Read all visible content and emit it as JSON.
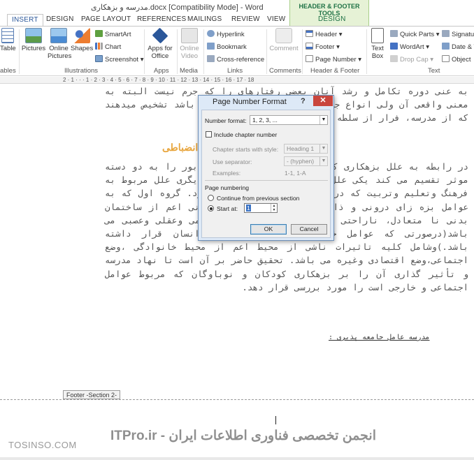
{
  "window": {
    "title": "مدرسه و بزهکاری.docx [Compatibility Mode] - Word",
    "contextual_group": "HEADER & FOOTER TOOLS"
  },
  "tabs": [
    "INSERT",
    "DESIGN",
    "PAGE LAYOUT",
    "REFERENCES",
    "MAILINGS",
    "REVIEW",
    "VIEW",
    "DESIGN"
  ],
  "ribbon": {
    "table_partial": "Table",
    "tables_group_partial": "ables",
    "pictures": "Pictures",
    "online_pictures": "Online Pictures",
    "shapes": "Shapes",
    "smartart": "SmartArt",
    "chart": "Chart",
    "screenshot": "Screenshot",
    "illustrations_group": "Illustrations",
    "apps_for_office": "Apps for Office",
    "apps_group": "Apps",
    "online_video": "Online Video",
    "media_group": "Media",
    "hyperlink": "Hyperlink",
    "bookmark": "Bookmark",
    "cross_reference": "Cross-reference",
    "links_group": "Links",
    "comment": "Comment",
    "comments_group": "Comments",
    "header": "Header",
    "footer": "Footer",
    "page_number": "Page Number",
    "header_footer_group": "Header & Footer",
    "text_box": "Text Box",
    "quick_parts": "Quick Parts",
    "wordart": "WordArt",
    "drop_cap": "Drop Cap",
    "signature_partial": "Signatu",
    "date_time_partial": "Date & T",
    "object": "Object",
    "text_group": "Text"
  },
  "ruler": {
    "ticks": "2 · 1 · · · 1 · 2 · 3 · 4 · 5 · 6 · 7 · 8 · 9 · 10 · 11 · 12 · 13 · 14 · 15 · 16 · 17 · 18"
  },
  "document": {
    "para1": "به عنی دوره تکامل و رشد آنان بعضی رفتارهای را که جرم نیست البته به معنی واقعی آن ولی انواع جرایم و حرفهای شدن آنان می باشد تشخیص میدهند که از مدرسه، فرار از سلطه والدین و خانواده و ....",
    "heading": "بزهکاری و بی انضباطی",
    "para2": "در رابطه به علل بزهکاری کودکان و نوجوانان عوامل مابور را به دو دسته موثر تقسیم می کند یکی علل مربوط به شخص بزهکار و دیگری علل مربوط به فرهنگ وتعلیم وتربیت که در خارج از وجود او قرار دارد. گروه اول که به عوامل بزه زای درونی و ذاتی و خصوصیات انسانی وروانی اعم از ساختمان بدنی نا متعادل، ناراحتی های روانی، بیماری های جسمی وعقلی وعصبی می باشد(درصورتی که عوامل خارجی در خارج از شخص انسان قرار داشته باشد.)وشامل کلیه تاثیرات ناشی از محیط اعم از محیط خانوادگی ،وضع اجتماعی،وضع اقتصادی وغیره می باشد. تحقیق حاضر بر آن است تا نهاد مدرسه و تأثیر گذاری آن را بر بزهکاری کودکان و نوباوگان که مربوط عوامل اجتماعی و خارجی است را مورد بررسی قرار دهد.",
    "subhead": "مدرسه عامل جامعه پذیری :"
  },
  "footer": {
    "section_tag": "Footer -Section 2-",
    "watermark_left": "TOSINSO.COM",
    "watermark_main": "ITPro.ir - انجمن تخصصی فناوری اطلاعات ایران"
  },
  "dialog": {
    "title": "Page Number Format",
    "help": "?",
    "close": "✕",
    "number_format_label": "Number format:",
    "number_format_value": "1, 2, 3, ...",
    "include_chapter_label": "Include chapter number",
    "include_chapter_checked": false,
    "chapter_style_label": "Chapter starts with style:",
    "chapter_style_value": "Heading 1",
    "use_separator_label": "Use separator:",
    "separator_value": "-   (hyphen)",
    "examples_label": "Examples:",
    "examples_value": "1-1, 1-A",
    "page_numbering_label": "Page numbering",
    "continue_label": "Continue from previous section",
    "start_at_label": "Start at:",
    "start_at_value": "1",
    "selected_option": "start_at",
    "ok": "OK",
    "cancel": "Cancel"
  },
  "colors": {
    "accent_blue": "#2b579a",
    "contextual_green": "#1e7145",
    "close_red": "#c9463d",
    "heading_orange": "#e8a53c"
  }
}
